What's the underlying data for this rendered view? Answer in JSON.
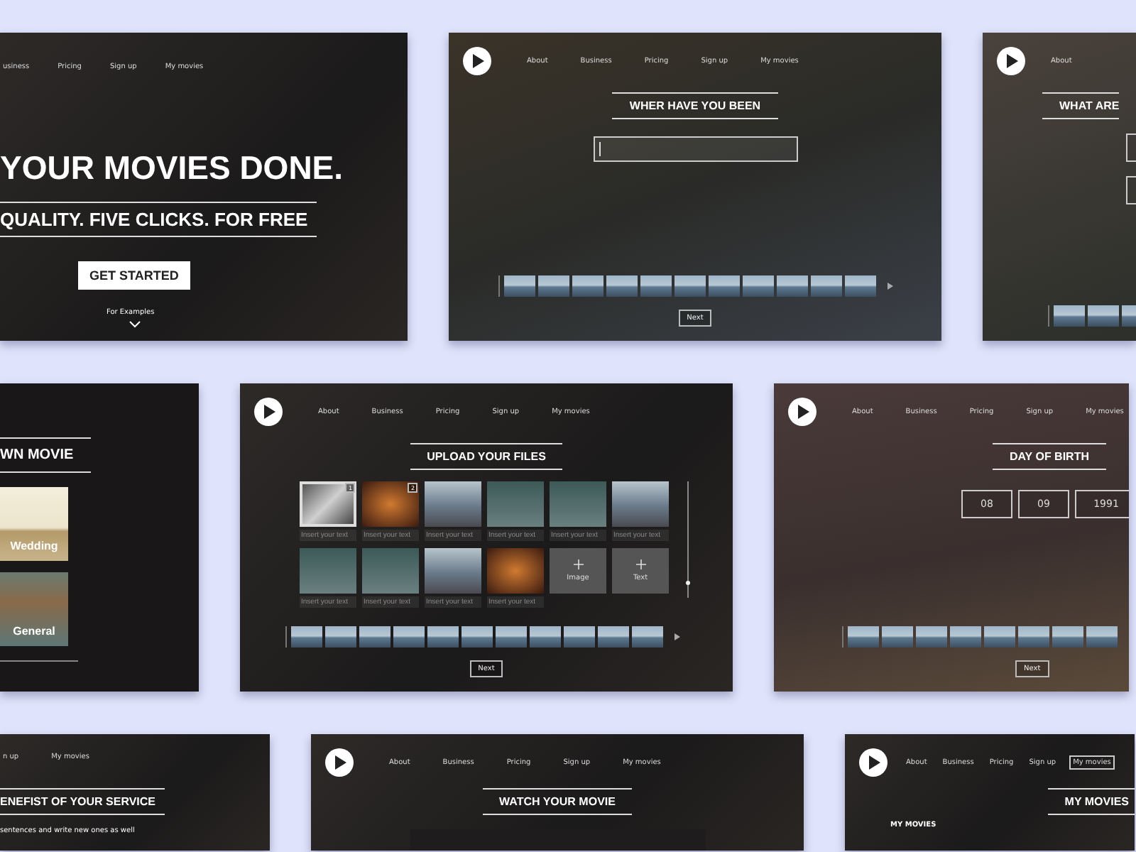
{
  "rows": [
    {
      "screens": [
        {
          "kind": "hero",
          "nav": {
            "links": [
              {
                "label": "usiness",
                "selected": false
              },
              {
                "label": "Pricing",
                "selected": false
              },
              {
                "label": "Sign up",
                "selected": false
              },
              {
                "label": "My movies",
                "selected": false
              }
            ]
          },
          "headline": "YOUR MOVIES DONE.",
          "subline": "QUALITY. FIVE CLICKS. FOR FREE",
          "cta": "GET STARTED",
          "hint": "For Examples"
        },
        {
          "kind": "location",
          "nav": {
            "logo": true,
            "links": [
              {
                "label": "About",
                "selected": false
              },
              {
                "label": "Business",
                "selected": false
              },
              {
                "label": "Pricing",
                "selected": false
              },
              {
                "label": "Sign up",
                "selected": false
              },
              {
                "label": "My movies",
                "selected": false
              }
            ]
          },
          "title": "WHER HAVE YOU BEEN",
          "input": {
            "focused": true
          },
          "frames": [
            {
              "kind": "landscape"
            },
            {
              "kind": "landscape"
            },
            {
              "kind": "landscape"
            },
            {
              "kind": "landscape"
            },
            {
              "kind": "landscape"
            },
            {
              "kind": "landscape"
            },
            {
              "kind": "landscape"
            },
            {
              "kind": "landscape"
            },
            {
              "kind": "landscape"
            },
            {
              "kind": "landscape"
            },
            {
              "kind": "landscape"
            }
          ],
          "next": "Next"
        },
        {
          "kind": "question",
          "nav": {
            "logo": true,
            "links": [
              {
                "label": "About",
                "selected": false
              }
            ]
          },
          "title": "WHAT ARE",
          "inputs": [
            {
              "focused": false
            },
            {
              "focused": false
            }
          ],
          "frames": [
            {
              "kind": "landscape"
            },
            {
              "kind": "landscape"
            },
            {
              "kind": "landscape"
            }
          ]
        }
      ]
    },
    {
      "screens": [
        {
          "kind": "occasion",
          "title": "WN MOVIE",
          "options": [
            {
              "label": "Wedding"
            },
            {
              "label": "General"
            }
          ]
        },
        {
          "kind": "upload",
          "nav": {
            "logo": true,
            "links": [
              {
                "label": "About",
                "selected": false
              },
              {
                "label": "Business",
                "selected": false
              },
              {
                "label": "Pricing",
                "selected": false
              },
              {
                "label": "Sign up",
                "selected": false
              },
              {
                "label": "My movies",
                "selected": false
              }
            ]
          },
          "title": "UPLOAD YOUR FILES",
          "tiles": [
            {
              "kind": "photo",
              "selected": true,
              "badge": "1",
              "placeholder": "Insert your text"
            },
            {
              "kind": "photo",
              "selected": false,
              "badge": "2",
              "placeholder": "Insert your text"
            },
            {
              "kind": "photo",
              "selected": false,
              "placeholder": "Insert your text"
            },
            {
              "kind": "photo",
              "selected": false,
              "placeholder": "Insert your text"
            },
            {
              "kind": "photo",
              "selected": false,
              "placeholder": "Insert your text"
            },
            {
              "kind": "photo",
              "selected": false,
              "placeholder": "Insert your text"
            },
            {
              "kind": "photo",
              "selected": false,
              "placeholder": "Insert your text"
            },
            {
              "kind": "photo",
              "selected": false,
              "placeholder": "Insert your text"
            },
            {
              "kind": "photo",
              "selected": false,
              "placeholder": "Insert your text"
            },
            {
              "kind": "photo",
              "selected": false,
              "placeholder": "Insert your text"
            },
            {
              "kind": "add",
              "label": "Image"
            },
            {
              "kind": "add",
              "label": "Text"
            }
          ],
          "frames": [
            {
              "kind": "landscape"
            },
            {
              "kind": "landscape"
            },
            {
              "kind": "landscape"
            },
            {
              "kind": "landscape"
            },
            {
              "kind": "landscape"
            },
            {
              "kind": "landscape"
            },
            {
              "kind": "landscape"
            },
            {
              "kind": "landscape"
            },
            {
              "kind": "landscape"
            },
            {
              "kind": "landscape"
            },
            {
              "kind": "landscape"
            }
          ],
          "next": "Next"
        },
        {
          "kind": "birthday",
          "nav": {
            "logo": true,
            "links": [
              {
                "label": "About",
                "selected": false
              },
              {
                "label": "Business",
                "selected": false
              },
              {
                "label": "Pricing",
                "selected": false
              },
              {
                "label": "Sign up",
                "selected": false
              },
              {
                "label": "My movies",
                "selected": false
              }
            ]
          },
          "title": "DAY OF BIRTH",
          "date": [
            "08",
            "09",
            "1991"
          ],
          "frames": [
            {
              "kind": "landscape"
            },
            {
              "kind": "landscape"
            },
            {
              "kind": "landscape"
            },
            {
              "kind": "landscape"
            },
            {
              "kind": "landscape"
            },
            {
              "kind": "landscape"
            },
            {
              "kind": "landscape"
            },
            {
              "kind": "landscape"
            }
          ],
          "next": "Next"
        }
      ]
    },
    {
      "screens": [
        {
          "kind": "benefits",
          "nav": {
            "links": [
              {
                "label": "n up",
                "selected": false
              },
              {
                "label": "My movies",
                "selected": false
              }
            ]
          },
          "title": "ENEFIST OF YOUR SERVICE",
          "text": "sentences and write new ones as well"
        },
        {
          "kind": "watch",
          "nav": {
            "logo": true,
            "links": [
              {
                "label": "About",
                "selected": false
              },
              {
                "label": "Business",
                "selected": false
              },
              {
                "label": "Pricing",
                "selected": false
              },
              {
                "label": "Sign up",
                "selected": false
              },
              {
                "label": "My movies",
                "selected": false
              }
            ]
          },
          "title": "WATCH YOUR MOVIE"
        },
        {
          "kind": "mymovies",
          "nav": {
            "logo": true,
            "links": [
              {
                "label": "About",
                "selected": false
              },
              {
                "label": "Business",
                "selected": false
              },
              {
                "label": "Pricing",
                "selected": false
              },
              {
                "label": "Sign up",
                "selected": false
              },
              {
                "label": "My movies",
                "selected": true
              }
            ]
          },
          "title": "MY MOVIES",
          "subheading": "MY MOVIES"
        }
      ]
    }
  ]
}
